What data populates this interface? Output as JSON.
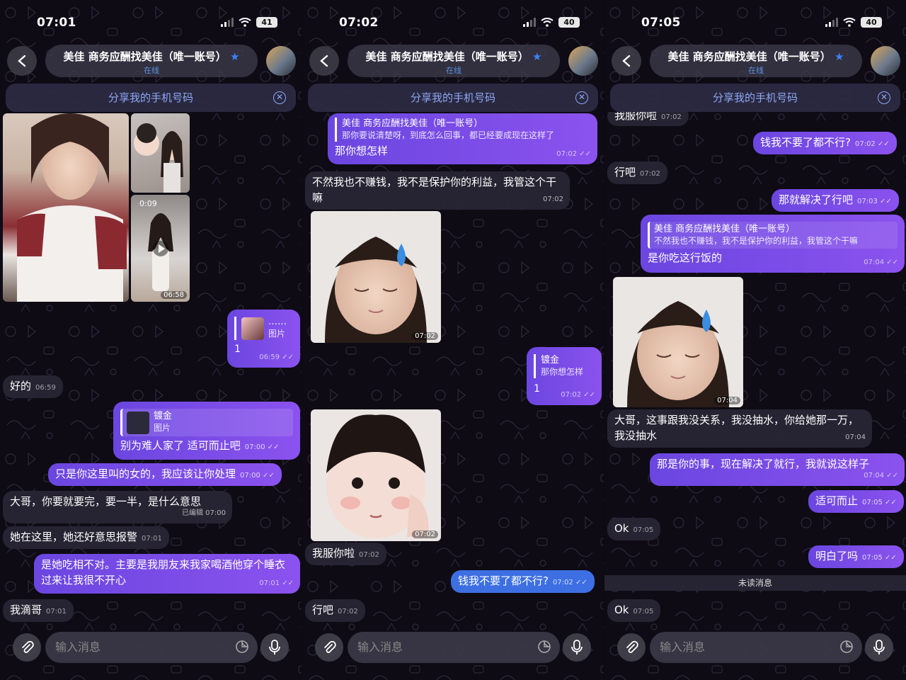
{
  "header": {
    "title": "美佳 商务应酬找美佳（唯一账号）",
    "status": "在线",
    "share_banner": "分享我的手机号码",
    "input_placeholder": "输入消息"
  },
  "colors": {
    "outgoing": "#7b4ee8",
    "incoming": "#28263a",
    "accent": "#3b82f6",
    "share_text": "#8fa7f5"
  },
  "panels": [
    {
      "time": "07:01",
      "battery": "41",
      "media": {
        "video_duration": "0:09",
        "video_time": "06:58"
      },
      "messages": [
        {
          "text": "",
          "quote_sender": "……",
          "quote_text": "图片",
          "reply": "1",
          "time": "06:59"
        },
        {
          "text": "好的",
          "time": "06:59"
        },
        {
          "quote_sender": "镀金",
          "quote_text": "图片",
          "text": "别为难人家了  适可而止吧",
          "time": "07:00"
        },
        {
          "text": "只是你这里叫的女的，我应该让你处理",
          "time": "07:00"
        },
        {
          "text": "大哥，你要就要完，要一半，是什么意思",
          "time": "已编辑 07:00"
        },
        {
          "text": "她在这里，她还好意思报警",
          "time": "07:01"
        },
        {
          "text": "是她吃相不对。主要是我朋友来我家喝酒他穿个睡衣过来让我很不开心",
          "time": "07:01"
        },
        {
          "text": "我滴哥",
          "time": "07:01"
        }
      ]
    },
    {
      "time": "07:02",
      "battery": "40",
      "messages": [
        {
          "quote_sender": "美佳 商务应酬找美佳（唯一账号）",
          "quote_text": "那你要说清楚呀，到底怎么回事，都已经要成现在这样了",
          "text": "那你想怎样",
          "time": "07:02"
        },
        {
          "text": "不然我也不赚钱，我不是保护你的利益，我管这个干嘛",
          "time": "07:02"
        },
        {
          "sticker": "sticker-sweat",
          "time": "07:02"
        },
        {
          "quote_sender": "镀金",
          "quote_text": "那你想怎样",
          "text": "1",
          "time": "07:02"
        },
        {
          "sticker": "sticker-baby",
          "time": "07:02"
        },
        {
          "text": "我服你啦",
          "time": "07:02"
        },
        {
          "text": "钱我不要了都不行?",
          "time": "07:02"
        },
        {
          "text": "行吧",
          "time": "07:02"
        }
      ]
    },
    {
      "time": "07:05",
      "battery": "40",
      "messages": [
        {
          "text": "我服你啦",
          "time": "07:02"
        },
        {
          "text": "钱我不要了都不行?",
          "time": "07:02"
        },
        {
          "text": "行吧",
          "time": "07:02"
        },
        {
          "text": "那就解决了行吧",
          "time": "07:03"
        },
        {
          "quote_sender": "美佳 商务应酬找美佳（唯一账号）",
          "quote_text": "不然我也不赚钱，我不是保护你的利益，我管这个干嘛",
          "text": "是你吃这行饭的",
          "time": "07:04"
        },
        {
          "sticker": "sticker-sweat",
          "time": "07:04"
        },
        {
          "text": "大哥，这事跟我没关系，我没抽水，你给她那一万，我没抽水",
          "time": "07:04"
        },
        {
          "text": "那是你的事，现在解决了就行，我就说这样子",
          "time": "07:04"
        },
        {
          "text": "适可而止",
          "time": "07:05"
        },
        {
          "text": "Ok",
          "time": "07:05"
        },
        {
          "text": "明白了吗",
          "time": "07:05"
        },
        {
          "text": "Ok",
          "time": "07:05"
        }
      ],
      "unread_label": "未读消息"
    }
  ]
}
